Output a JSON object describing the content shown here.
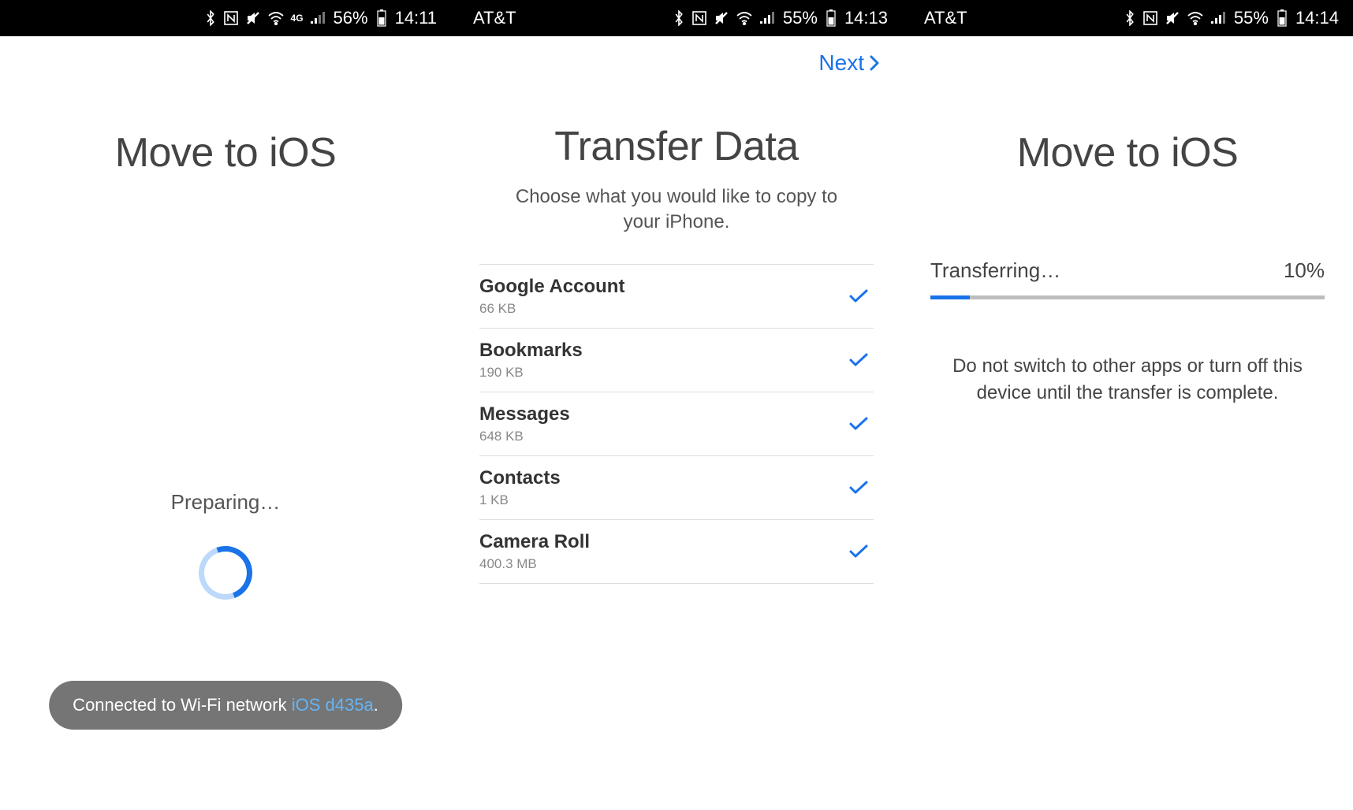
{
  "panel1": {
    "statusbar": {
      "carrier": "",
      "battery_pct": "56%",
      "time": "14:11"
    },
    "title": "Move to iOS",
    "preparing": "Preparing…",
    "toast_prefix": "Connected to Wi-Fi network ",
    "toast_network": "iOS d435a",
    "toast_suffix": "."
  },
  "panel2": {
    "statusbar": {
      "carrier": "AT&T",
      "battery_pct": "55%",
      "time": "14:13"
    },
    "next_label": "Next",
    "title": "Transfer Data",
    "subtitle": "Choose what you would like to copy to your iPhone.",
    "items": [
      {
        "title": "Google Account",
        "size": "66 KB"
      },
      {
        "title": "Bookmarks",
        "size": "190 KB"
      },
      {
        "title": "Messages",
        "size": "648 KB"
      },
      {
        "title": "Contacts",
        "size": "1 KB"
      },
      {
        "title": "Camera Roll",
        "size": "400.3 MB"
      }
    ]
  },
  "panel3": {
    "statusbar": {
      "carrier": "AT&T",
      "battery_pct": "55%",
      "time": "14:14"
    },
    "title": "Move to iOS",
    "transferring_label": "Transferring…",
    "progress_pct_label": "10%",
    "progress_pct_value": 10,
    "message": "Do not switch to other apps or turn off this device until the transfer is complete."
  },
  "colors": {
    "accent": "#1a73e8"
  }
}
